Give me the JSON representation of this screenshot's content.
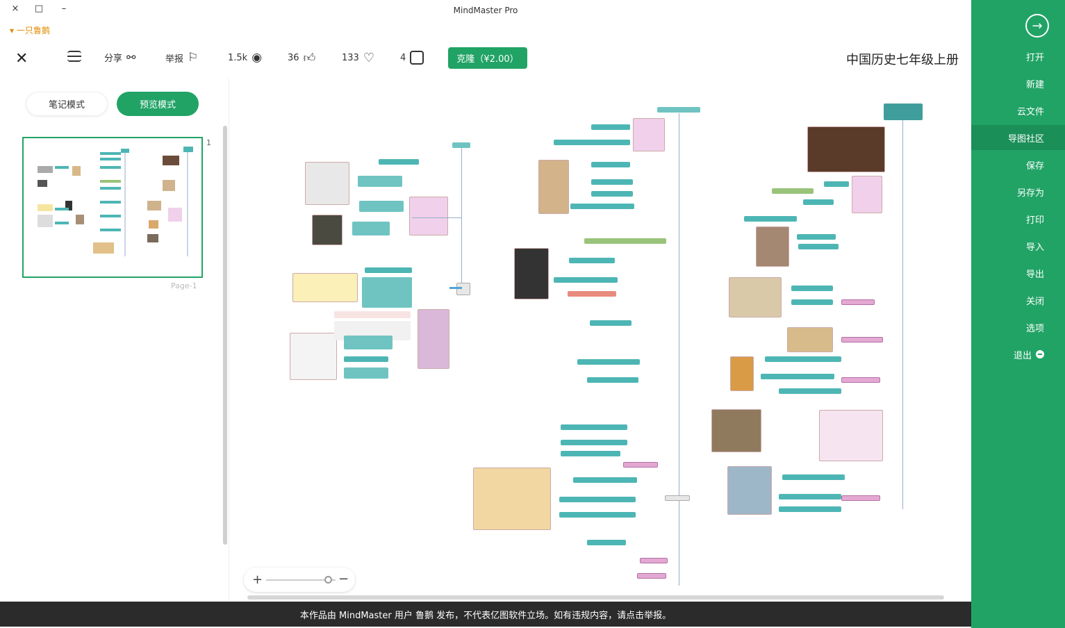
{
  "window": {
    "title": "MindMaster Pro",
    "minimize_label": "–",
    "maximize_label": "□",
    "close_label": "×"
  },
  "user": {
    "name": "▾ 一只鲁鹅"
  },
  "toolbar": {
    "doc_title": "中国历史七年级上册",
    "buy_label": "克隆（¥2.00）",
    "pages_count": "4",
    "likes_count": "133",
    "thumbs_count": "36",
    "views_count": "1.5k",
    "report_label": "举报",
    "share_label": "分享"
  },
  "sidebar": {
    "items": [
      {
        "label": "打开"
      },
      {
        "label": "新建"
      },
      {
        "label": "云文件"
      },
      {
        "label": "导图社区"
      },
      {
        "label": "保存"
      },
      {
        "label": "另存为"
      },
      {
        "label": "打印"
      },
      {
        "label": "导入"
      },
      {
        "label": "导出"
      },
      {
        "label": "关闭"
      },
      {
        "label": "选项"
      },
      {
        "label": "退出"
      }
    ],
    "active_index": 3
  },
  "left_panel": {
    "preview_mode_label": "预览模式",
    "note_mode_label": "笔记模式",
    "page_number": "1",
    "page_label": "Page-1"
  },
  "footer": {
    "notice": "本作品由 MindMaster 用户 鲁鹅 发布，不代表亿图软件立场。如有违规内容，请点击举报。"
  },
  "mindmap": {
    "root_label": "中国历史七年级上册",
    "colors": {
      "accent": "#21a366",
      "branch": "#4db6b4",
      "highlight": "#e3a9d3"
    }
  }
}
